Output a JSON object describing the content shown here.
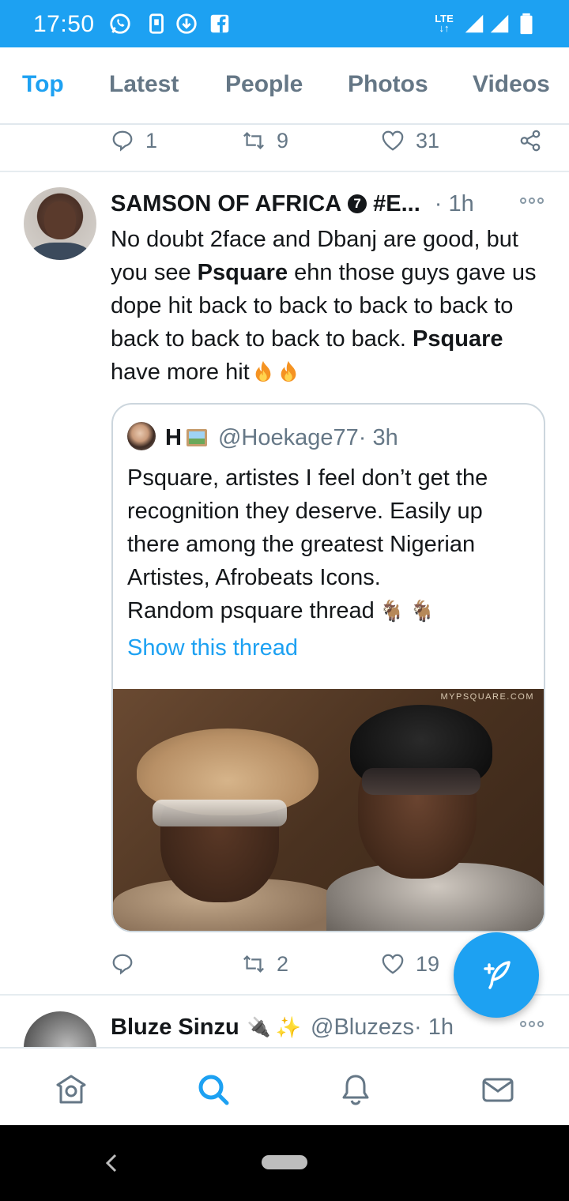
{
  "status_bar": {
    "time": "17:50",
    "network_label": "LTE"
  },
  "tabs": [
    {
      "label": "Top",
      "active": true
    },
    {
      "label": "Latest",
      "active": false
    },
    {
      "label": "People",
      "active": false
    },
    {
      "label": "Photos",
      "active": false
    },
    {
      "label": "Videos",
      "active": false
    }
  ],
  "previous_tweet_actions": {
    "replies": "1",
    "retweets": "9",
    "likes": "31"
  },
  "tweet": {
    "name": "SAMSON OF AFRICA",
    "badge": "7",
    "handle_truncated": "#E...",
    "time": "· 1h",
    "body_parts": {
      "p1": "No doubt 2face and Dbanj are good, but you see ",
      "b1": "Psquare",
      "p2": " ehn those guys gave us dope hit back to back to back to back to back to back to back to back. ",
      "b2": "Psquare",
      "p3": " have more hit"
    },
    "quote": {
      "name": "H",
      "handle": "@Hoekage77",
      "time": " · 3h",
      "body": "Psquare, artistes I feel don’t get the recognition they deserve. Easily up there among the greatest Nigerian Artistes, Afrobeats Icons.",
      "body_line2": "Random psquare thread",
      "link": "Show this thread",
      "image_watermark": "MYPSQUARE.COM"
    },
    "actions": {
      "replies": "",
      "retweets": "2",
      "likes": "19"
    }
  },
  "next_tweet": {
    "name": "Bluze Sinzu",
    "handle": "@Bluzezs",
    "time": " · 1h"
  },
  "colors": {
    "brand": "#1da1f2",
    "text": "#14171a",
    "muted": "#657786"
  }
}
